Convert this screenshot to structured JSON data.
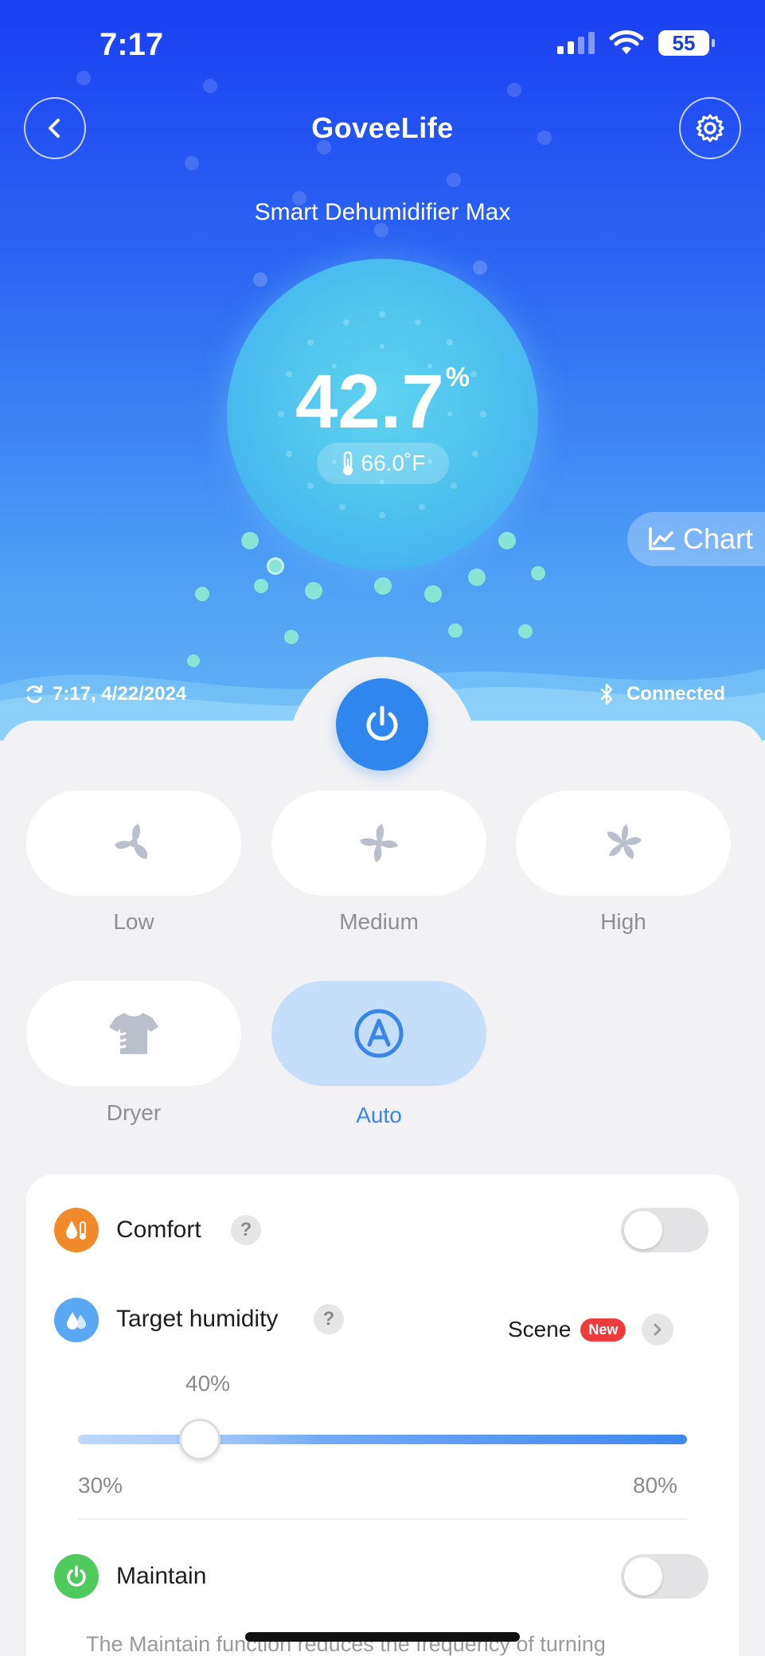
{
  "status_bar": {
    "time": "7:17",
    "battery": "55"
  },
  "header": {
    "brand": "GoveeLife",
    "device_name": "Smart Dehumidifier Max"
  },
  "reading": {
    "humidity_value": "42.7",
    "humidity_unit": "%",
    "temperature": "66.0˚F"
  },
  "chart_button": {
    "label": "Chart"
  },
  "sync": {
    "time": "7:17,  4/22/2024"
  },
  "connection": {
    "status": "Connected"
  },
  "modes": {
    "low": "Low",
    "medium": "Medium",
    "high": "High",
    "dryer": "Dryer",
    "auto": "Auto",
    "selected": "Auto"
  },
  "settings": {
    "comfort_label": "Comfort",
    "comfort_on": false,
    "target_humidity_label": "Target humidity",
    "scene_label": "Scene",
    "scene_badge": "New",
    "target_value": "40%",
    "target_fraction": 0.2,
    "range_min": "30%",
    "range_max": "80%",
    "maintain_label": "Maintain",
    "maintain_on": false,
    "maintain_desc": "The Maintain function reduces the frequency of turning"
  },
  "colors": {
    "accent": "#2f86ee",
    "comfort_icon": "#f08a2a",
    "humidity_icon": "#5aa8f2",
    "maintain_icon": "#4fca5c",
    "new_badge": "#ee3b3b"
  }
}
